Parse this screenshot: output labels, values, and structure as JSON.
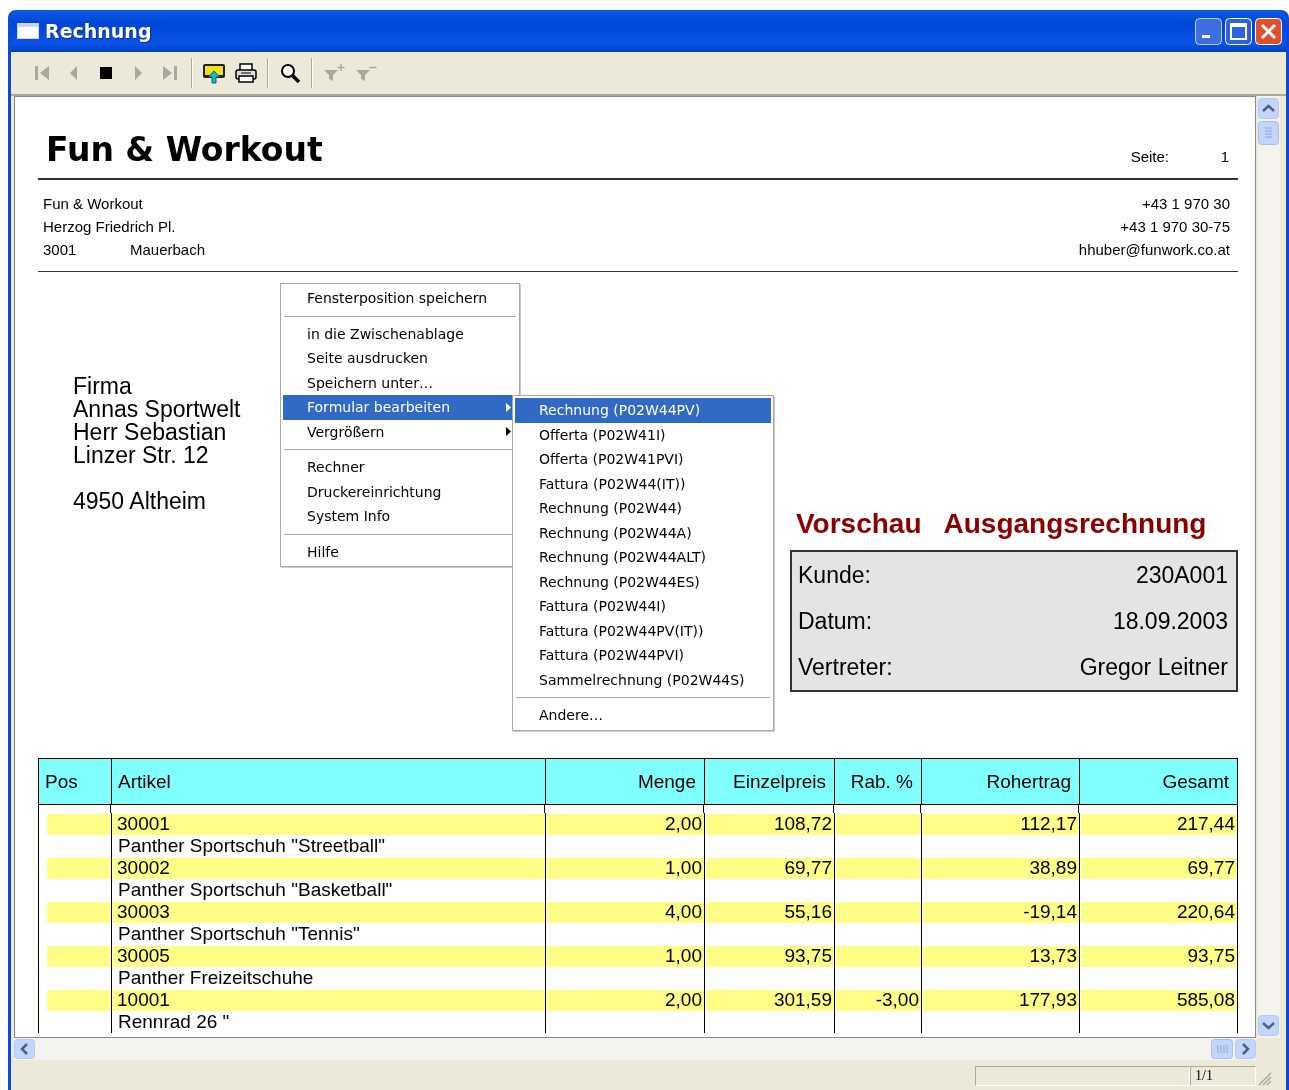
{
  "window": {
    "title": "Rechnung",
    "controls": [
      {
        "kind": "minimize"
      },
      {
        "kind": "maximize"
      },
      {
        "kind": "close"
      }
    ]
  },
  "toolbar": [
    {
      "kind": "first",
      "disabled": true
    },
    {
      "kind": "prev",
      "disabled": true
    },
    {
      "kind": "stop",
      "disabled": false
    },
    {
      "kind": "next",
      "disabled": true
    },
    {
      "kind": "last",
      "disabled": true
    },
    {
      "kind": "separator"
    },
    {
      "kind": "export",
      "disabled": false
    },
    {
      "kind": "print",
      "disabled": false
    },
    {
      "kind": "separator"
    },
    {
      "kind": "search",
      "disabled": false
    },
    {
      "kind": "separator"
    },
    {
      "kind": "filter-add",
      "disabled": true
    },
    {
      "kind": "filter-remove",
      "disabled": true
    }
  ],
  "report": {
    "company": "Fun & Workout",
    "page_label": "Seite:",
    "page_number": "1",
    "sender_lines": [
      "Fun & Workout",
      "Herzog Friedrich Pl."
    ],
    "sender_zip": "3001",
    "sender_city": "Mauerbach",
    "contact_lines": [
      "+43 1 970 30",
      "+43 1 970 30-75",
      "hhuber@funwork.co.at"
    ],
    "recipient_lines": [
      "Firma",
      "Annas Sportwelt",
      "Herr Sebastian",
      "Linzer Str. 12"
    ],
    "recipient_city": "4950 Altheim",
    "preview_label": "Vorschau",
    "document_title": "Ausgangsrechnung",
    "info": [
      {
        "label": "Kunde:",
        "value": "230A001"
      },
      {
        "label": "Datum:",
        "value": "18.09.2003"
      },
      {
        "label": "Vertreter:",
        "value": "Gregor Leitner"
      }
    ],
    "table": {
      "columns": [
        "Pos",
        "Artikel",
        "Menge",
        "Einzelpreis",
        "Rab. %",
        "Rohertrag",
        "Gesamt"
      ],
      "rows": [
        {
          "article_no": "30001",
          "description": "Panther Sportschuh \"Streetball\"",
          "menge": "2,00",
          "einzelpreis": "108,72",
          "rohertrag": "112,17",
          "gesamt": "217,44"
        },
        {
          "article_no": "30002",
          "description": "Panther Sportschuh \"Basketball\"",
          "menge": "1,00",
          "einzelpreis": "69,77",
          "rohertrag": "38,89",
          "gesamt": "69,77"
        },
        {
          "article_no": "30003",
          "description": "Panther Sportschuh \"Tennis\"",
          "menge": "4,00",
          "einzelpreis": "55,16",
          "rohertrag": "-19,14",
          "gesamt": "220,64"
        },
        {
          "article_no": "30005",
          "description": "Panther Freizeitschuhe",
          "menge": "1,00",
          "einzelpreis": "93,75",
          "rohertrag": "13,73",
          "gesamt": "93,75"
        },
        {
          "article_no": "10001",
          "description": "Rennrad 26 \"",
          "menge": "2,00",
          "einzelpreis": "301,59",
          "rabatt": "-3,00",
          "rohertrag": "177,93",
          "gesamt": "585,08"
        }
      ]
    }
  },
  "context_menu": {
    "groups": [
      [
        {
          "label": "Fensterposition speichern",
          "selected": false,
          "has_submenu": false
        }
      ],
      [
        {
          "label": "in die Zwischenablage",
          "selected": false,
          "has_submenu": false
        },
        {
          "label": "Seite ausdrucken",
          "selected": false,
          "has_submenu": false
        },
        {
          "label": "Speichern unter…",
          "selected": false,
          "has_submenu": false
        },
        {
          "label": "Formular bearbeiten",
          "selected": true,
          "has_submenu": true
        },
        {
          "label": "Vergrößern",
          "selected": false,
          "has_submenu": true
        }
      ],
      [
        {
          "label": "Rechner",
          "selected": false,
          "has_submenu": false
        },
        {
          "label": "Druckereinrichtung",
          "selected": false,
          "has_submenu": false
        },
        {
          "label": "System Info",
          "selected": false,
          "has_submenu": false
        }
      ],
      [
        {
          "label": "Hilfe",
          "selected": false,
          "has_submenu": false
        }
      ]
    ]
  },
  "submenu": {
    "groups": [
      [
        {
          "label": "Rechnung (P02W44PV)",
          "selected": true,
          "has_submenu": false
        },
        {
          "label": "Offerta (P02W41I)",
          "selected": false,
          "has_submenu": false
        },
        {
          "label": "Offerta (P02W41PVI)",
          "selected": false,
          "has_submenu": false
        },
        {
          "label": "Fattura (P02W44(IT))",
          "selected": false,
          "has_submenu": false
        },
        {
          "label": "Rechnung (P02W44)",
          "selected": false,
          "has_submenu": false
        },
        {
          "label": "Rechnung (P02W44A)",
          "selected": false,
          "has_submenu": false
        },
        {
          "label": "Rechnung (P02W44ALT)",
          "selected": false,
          "has_submenu": false
        },
        {
          "label": "Rechnung (P02W44ES)",
          "selected": false,
          "has_submenu": false
        },
        {
          "label": "Fattura (P02W44I)",
          "selected": false,
          "has_submenu": false
        },
        {
          "label": "Fattura (P02W44PV(IT))",
          "selected": false,
          "has_submenu": false
        },
        {
          "label": "Fattura (P02W44PVI)",
          "selected": false,
          "has_submenu": false
        },
        {
          "label": "Sammelrechnung (P02W44S)",
          "selected": false,
          "has_submenu": false
        }
      ],
      [
        {
          "label": "Andere…",
          "selected": false,
          "has_submenu": false
        }
      ]
    ]
  },
  "status_bar": {
    "panels": [
      "1/1"
    ]
  }
}
